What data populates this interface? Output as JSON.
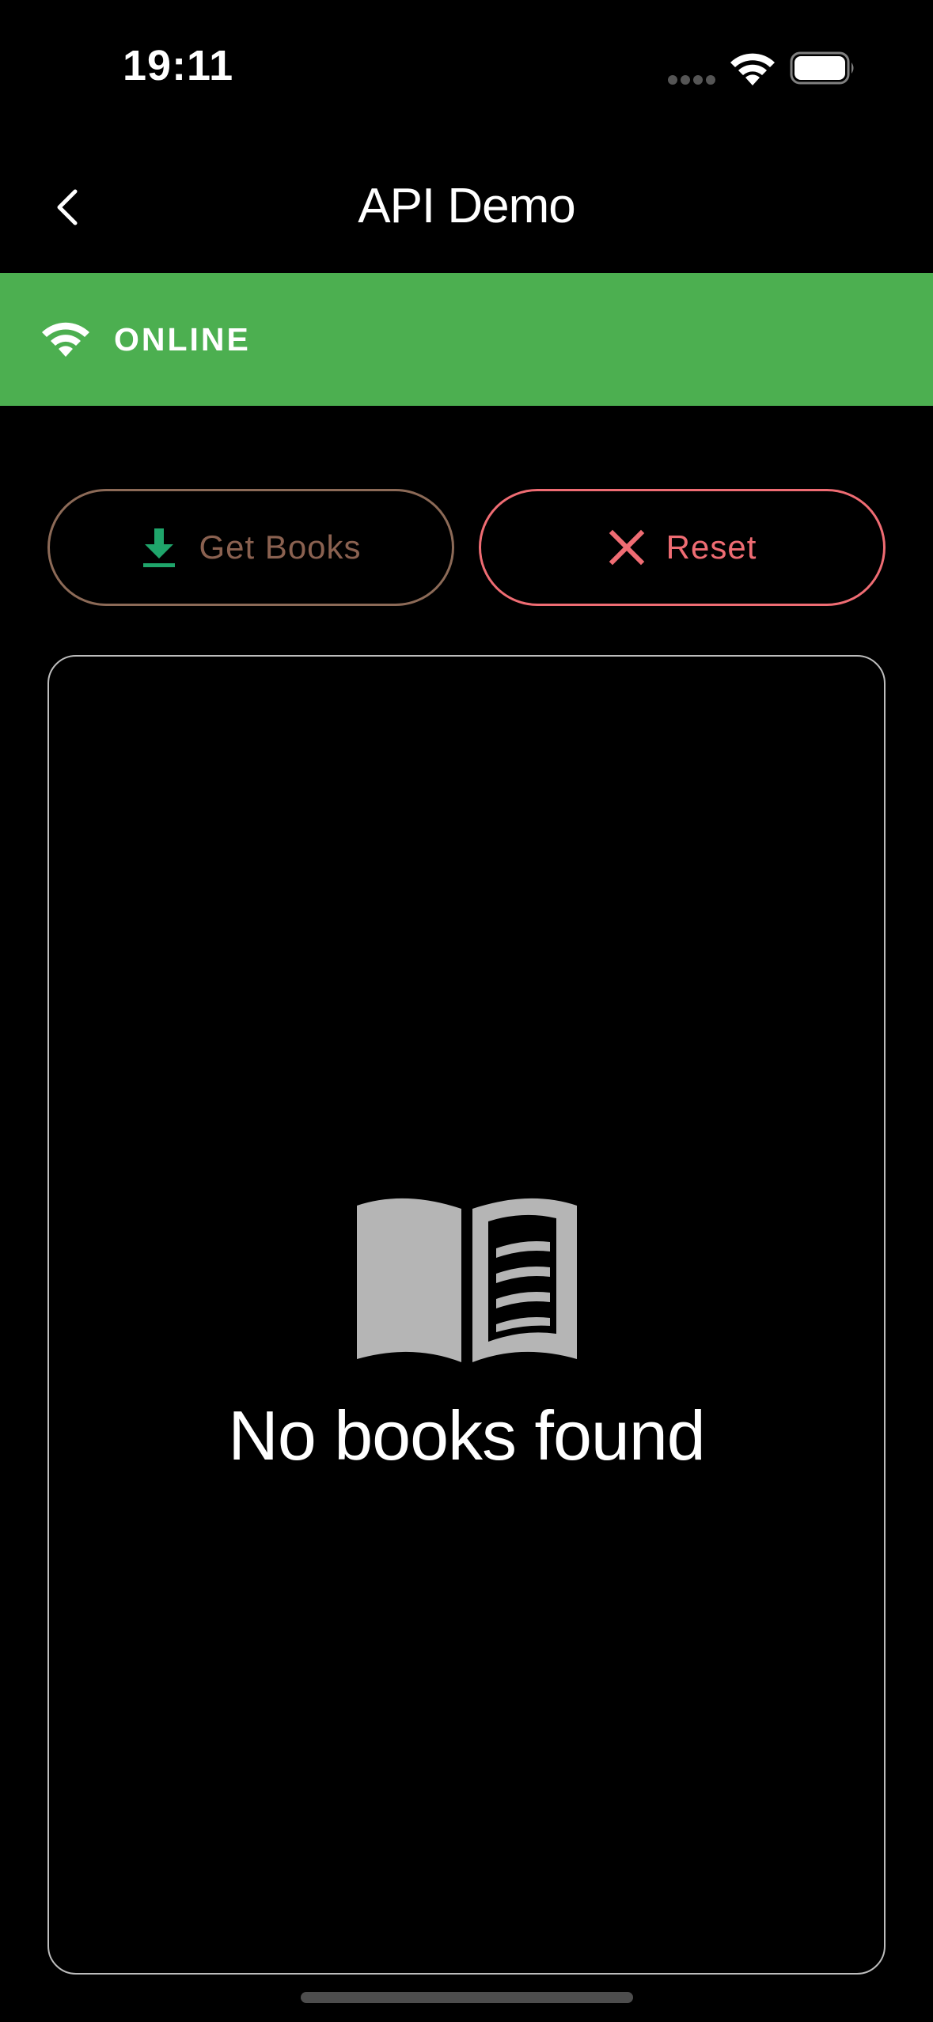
{
  "status_bar": {
    "time": "19:11",
    "icons": [
      "cellular-dots-icon",
      "wifi-icon",
      "battery-icon"
    ]
  },
  "nav": {
    "back_icon": "chevron-left-icon",
    "title": "API Demo"
  },
  "banner": {
    "icon": "wifi-icon",
    "label": "ONLINE",
    "color": "#4caf50"
  },
  "actions": {
    "get_books": {
      "label": "Get Books",
      "icon": "download-icon",
      "border_color": "#8c6a57",
      "icon_color": "#1fa56b"
    },
    "reset": {
      "label": "Reset",
      "icon": "close-icon",
      "color": "#ef6c73"
    }
  },
  "empty_state": {
    "icon": "open-book-icon",
    "message": "No books found"
  }
}
